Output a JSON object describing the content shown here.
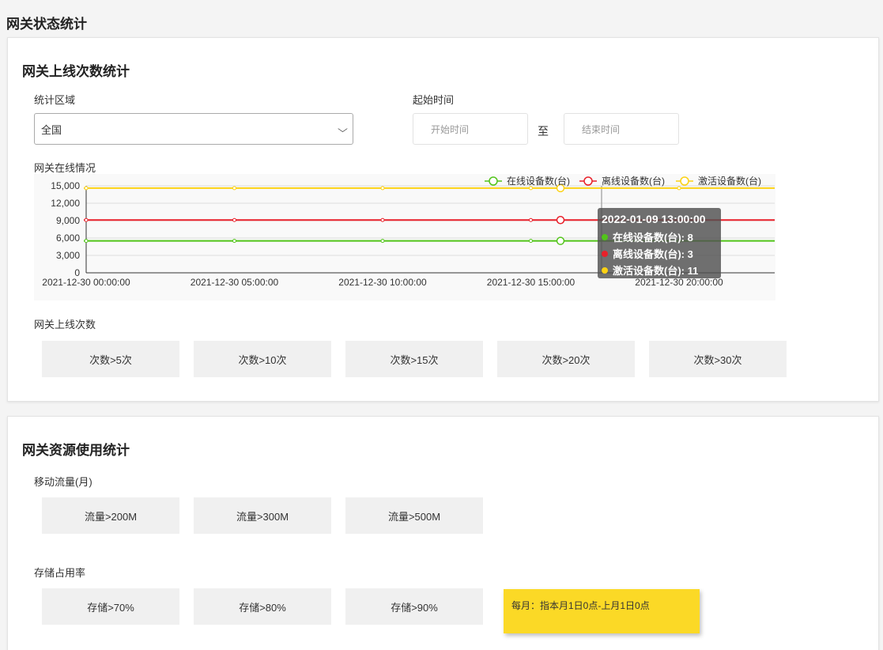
{
  "page_title": "网关状态统计",
  "online_section": {
    "title": "网关上线次数统计",
    "region_label": "统计区域",
    "region_value": "全国",
    "start_label": "起始时间",
    "start_placeholder": "开始时间",
    "to_label": "至",
    "end_placeholder": "结束时间",
    "chart_label": "网关在线情况",
    "count_label": "网关上线次数",
    "count_buttons": [
      "次数>5次",
      "次数>10次",
      "次数>15次",
      "次数>20次",
      "次数>30次"
    ]
  },
  "resource_section": {
    "title": "网关资源使用统计",
    "traffic_label": "移动流量(月)",
    "traffic_buttons": [
      "流量>200M",
      "流量>300M",
      "流量>500M"
    ],
    "storage_label": "存储占用率",
    "storage_buttons": [
      "存储>70%",
      "存储>80%",
      "存储>90%"
    ],
    "note": "每月：指本月1日0点-上月1日0点"
  },
  "chart_data": {
    "type": "line",
    "x": [
      "2021-12-30 00:00:00",
      "2021-12-30 05:00:00",
      "2021-12-30 10:00:00",
      "2021-12-30 15:00:00",
      "2021-12-30 20:00:00"
    ],
    "yticks": [
      "0",
      "3,000",
      "6,000",
      "9,000",
      "12,000",
      "15,000"
    ],
    "ylim": [
      0,
      15000
    ],
    "series": [
      {
        "name": "在线设备数(台)",
        "color": "#52c41a",
        "values": [
          5500,
          5500,
          5500,
          5500,
          5500
        ]
      },
      {
        "name": "离线设备数(台)",
        "color": "#e8202a",
        "values": [
          9100,
          9100,
          9100,
          9100,
          9100
        ]
      },
      {
        "name": "激活设备数(台)",
        "color": "#fcd213",
        "values": [
          14600,
          14600,
          14600,
          14600,
          14600
        ]
      }
    ],
    "legend_position": "top-right",
    "tooltip": {
      "title": "2022-01-09 13:00:00",
      "rows": [
        {
          "label": "在线设备数(台): 8",
          "color": "#52c41a"
        },
        {
          "label": "离线设备数(台): 3",
          "color": "#e8202a"
        },
        {
          "label": "激活设备数(台): 11",
          "color": "#fcd213"
        }
      ]
    }
  }
}
